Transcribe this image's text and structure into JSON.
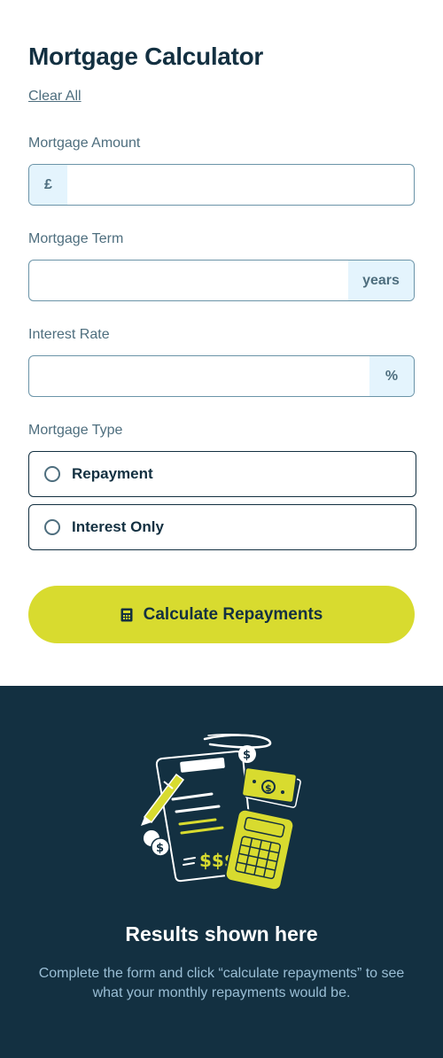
{
  "header": {
    "title": "Mortgage Calculator",
    "clear_all": "Clear All"
  },
  "fields": {
    "amount": {
      "label": "Mortgage Amount",
      "prefix": "£",
      "value": "",
      "placeholder": ""
    },
    "term": {
      "label": "Mortgage Term",
      "suffix": "years",
      "value": "",
      "placeholder": ""
    },
    "rate": {
      "label": "Interest Rate",
      "suffix": "%",
      "value": "",
      "placeholder": ""
    }
  },
  "mortgage_type": {
    "label": "Mortgage Type",
    "options": [
      "Repayment",
      "Interest Only"
    ],
    "selected": null
  },
  "calculate_button": {
    "label": "Calculate Repayments",
    "icon": "calculator-icon"
  },
  "results": {
    "illustration": "empty-results-illustration",
    "title": "Results shown here",
    "description": "Complete the form and click “calculate repayments” to see what your monthly repayments would be."
  },
  "colors": {
    "dark_slate": "#133041",
    "lime": "#d8db2f",
    "label_slate": "#4e6e7e",
    "addon_bg": "#e4f4fd",
    "results_text": "#9abed5"
  }
}
